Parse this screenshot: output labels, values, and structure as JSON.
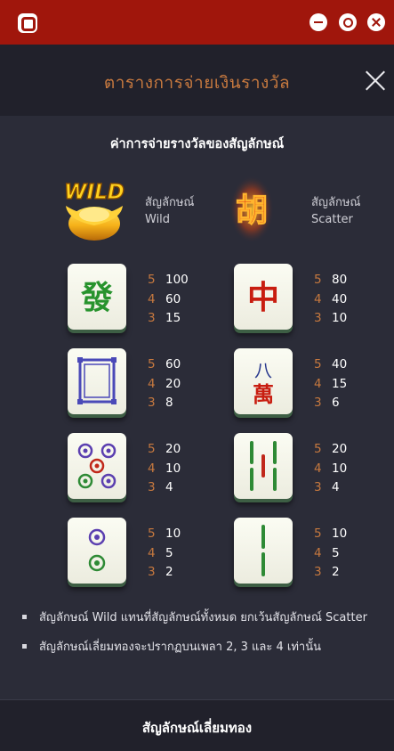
{
  "header": {
    "title": "ตารางการจ่ายเงินรางวัล"
  },
  "section": {
    "title": "ค่าการจ่ายรางวัลของสัญลักษณ์"
  },
  "special_symbols": {
    "wild": {
      "line1": "สัญลักษณ์",
      "line2": "Wild",
      "icon": "gold-ingot-wild-icon"
    },
    "scatter": {
      "line1": "สัญลักษณ์",
      "line2": "Scatter",
      "icon": "hu-scatter-icon"
    }
  },
  "paytable": [
    {
      "symbol": "green-fa-tile",
      "rows": [
        {
          "count": "5",
          "value": "100"
        },
        {
          "count": "4",
          "value": "60"
        },
        {
          "count": "3",
          "value": "15"
        }
      ]
    },
    {
      "symbol": "red-zhong-tile",
      "rows": [
        {
          "count": "5",
          "value": "80"
        },
        {
          "count": "4",
          "value": "40"
        },
        {
          "count": "3",
          "value": "10"
        }
      ]
    },
    {
      "symbol": "white-dragon-tile",
      "rows": [
        {
          "count": "5",
          "value": "60"
        },
        {
          "count": "4",
          "value": "20"
        },
        {
          "count": "3",
          "value": "8"
        }
      ]
    },
    {
      "symbol": "eight-wan-tile",
      "glyph_top": "八",
      "glyph_bottom": "萬",
      "rows": [
        {
          "count": "5",
          "value": "40"
        },
        {
          "count": "4",
          "value": "15"
        },
        {
          "count": "3",
          "value": "6"
        }
      ]
    },
    {
      "symbol": "five-dots-tile",
      "rows": [
        {
          "count": "5",
          "value": "20"
        },
        {
          "count": "4",
          "value": "10"
        },
        {
          "count": "3",
          "value": "4"
        }
      ]
    },
    {
      "symbol": "five-bamboo-tile",
      "rows": [
        {
          "count": "5",
          "value": "20"
        },
        {
          "count": "4",
          "value": "10"
        },
        {
          "count": "3",
          "value": "4"
        }
      ]
    },
    {
      "symbol": "two-dots-tile",
      "rows": [
        {
          "count": "5",
          "value": "10"
        },
        {
          "count": "4",
          "value": "5"
        },
        {
          "count": "3",
          "value": "2"
        }
      ]
    },
    {
      "symbol": "two-bamboo-tile",
      "rows": [
        {
          "count": "5",
          "value": "10"
        },
        {
          "count": "4",
          "value": "5"
        },
        {
          "count": "3",
          "value": "2"
        }
      ]
    }
  ],
  "notes": [
    "สัญลักษณ์ Wild แทนที่สัญลักษณ์ทั้งหมด ยกเว้นสัญลักษณ์ Scatter",
    "สัญลักษณ์เลี่ยมทองจะปรากฏบนเพลา 2, 3 และ 4 เท่านั้น"
  ],
  "footer": {
    "title": "สัญลักษณ์เลี่ยมทอง"
  },
  "colors": {
    "titlebar": "#a0160c",
    "accent": "#c7793f",
    "background": "#2b2c38"
  }
}
